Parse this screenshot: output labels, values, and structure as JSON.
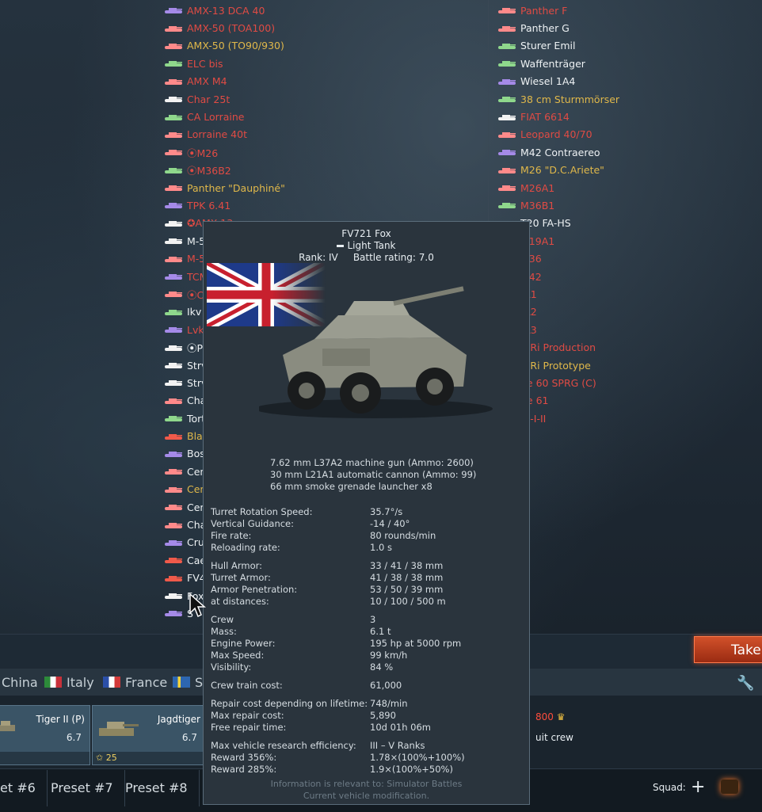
{
  "left_list": [
    {
      "name": "AMX-13 DCA 40",
      "color": "red",
      "icon": "spaa-purple"
    },
    {
      "name": "AMX-50 (TOA100)",
      "color": "red",
      "icon": "heavy-pink"
    },
    {
      "name": "AMX-50 (TO90/930)",
      "color": "gold",
      "icon": "heavy-pink"
    },
    {
      "name": "ELC bis",
      "color": "red",
      "icon": "light-green"
    },
    {
      "name": "AMX M4",
      "color": "red",
      "icon": "heavy-pink"
    },
    {
      "name": "Char 25t",
      "color": "red",
      "icon": "medium-white"
    },
    {
      "name": "CA Lorraine",
      "color": "red",
      "icon": "td-green"
    },
    {
      "name": "Lorraine 40t",
      "color": "red",
      "icon": "medium-pink"
    },
    {
      "name": "⦿M26",
      "color": "red",
      "icon": "heavy-pink"
    },
    {
      "name": "⦿M36B2",
      "color": "red",
      "icon": "td-green"
    },
    {
      "name": "Panther \"Dauphiné\"",
      "color": "gold",
      "icon": "medium-pink"
    },
    {
      "name": "TPK 6.41",
      "color": "red",
      "icon": "spaa-purple"
    },
    {
      "name": "✪AMX-13",
      "color": "red",
      "icon": "medium-white"
    },
    {
      "name": "M-5",
      "color": "white",
      "icon": "medium-white"
    },
    {
      "name": "M-5",
      "color": "red",
      "icon": "medium-pink"
    },
    {
      "name": "TCM",
      "color": "red",
      "icon": "spaa-purple"
    },
    {
      "name": "⦿C",
      "color": "red",
      "icon": "heavy-pink"
    },
    {
      "name": "Ikv",
      "color": "white",
      "icon": "td-green"
    },
    {
      "name": "Lvkv",
      "color": "red",
      "icon": "spaa-purple"
    },
    {
      "name": "⦿P",
      "color": "white",
      "icon": "medium-white"
    },
    {
      "name": "Strv",
      "color": "white",
      "icon": "medium-white"
    },
    {
      "name": "Strv",
      "color": "white",
      "icon": "medium-white"
    },
    {
      "name": "Cha",
      "color": "white",
      "icon": "heavy-pink"
    },
    {
      "name": "Tort",
      "color": "white",
      "icon": "td-green"
    },
    {
      "name": "Blac",
      "color": "gold",
      "icon": "heavy-red"
    },
    {
      "name": "Bosv",
      "color": "white",
      "icon": "spaa-purple"
    },
    {
      "name": "Cent",
      "color": "white",
      "icon": "medium-pink"
    },
    {
      "name": "Cent",
      "color": "gold",
      "icon": "medium-pink"
    },
    {
      "name": "Cent",
      "color": "white",
      "icon": "medium-pink"
    },
    {
      "name": "Cha",
      "color": "white",
      "icon": "heavy-pink"
    },
    {
      "name": "Crus",
      "color": "white",
      "icon": "spaa-purple"
    },
    {
      "name": "Cae",
      "color": "white",
      "icon": "heavy-red"
    },
    {
      "name": "FV4",
      "color": "white",
      "icon": "heavy-red"
    },
    {
      "name": "Fox",
      "color": "white",
      "icon": "light-white"
    },
    {
      "name": "S",
      "color": "white",
      "icon": "spaa-purple"
    }
  ],
  "right_list": [
    {
      "name": "Panther F",
      "color": "red",
      "icon": "medium-pink"
    },
    {
      "name": "Panther G",
      "color": "white",
      "icon": "medium-pink"
    },
    {
      "name": "Sturer Emil",
      "color": "white",
      "icon": "td-green"
    },
    {
      "name": "Waffenträger",
      "color": "white",
      "icon": "td-green"
    },
    {
      "name": "Wiesel 1A4",
      "color": "white",
      "icon": "spaa-purple"
    },
    {
      "name": "38 cm Sturmmörser",
      "color": "gold",
      "icon": "td-green"
    },
    {
      "name": "FIAT 6614",
      "color": "red",
      "icon": "light-white"
    },
    {
      "name": "Leopard 40/70",
      "color": "red",
      "icon": "medium-pink"
    },
    {
      "name": "M42 Contraereo",
      "color": "white",
      "icon": "spaa-purple"
    },
    {
      "name": "M26 \"D.C.Ariete\"",
      "color": "gold",
      "icon": "heavy-pink"
    },
    {
      "name": "M26A1",
      "color": "red",
      "icon": "heavy-pink"
    },
    {
      "name": "M36B1",
      "color": "red",
      "icon": "td-green"
    },
    {
      "name": "T20 FA-HS",
      "color": "white",
      "icon": "light-white"
    },
    {
      "name": "M19A1",
      "color": "red",
      "icon": "spaa-purple"
    },
    {
      "name": "M36",
      "color": "red",
      "icon": "td-green"
    },
    {
      "name": "M42",
      "color": "red",
      "icon": "spaa-purple"
    },
    {
      "name": "-A1",
      "color": "red",
      "icon": "medium-pink"
    },
    {
      "name": "-A2",
      "color": "red",
      "icon": "medium-pink"
    },
    {
      "name": "-A3",
      "color": "red",
      "icon": "medium-pink"
    },
    {
      "name": "o-Ri Production",
      "color": "red",
      "icon": "medium-pink"
    },
    {
      "name": "o-Ri Prototype",
      "color": "gold",
      "icon": "medium-pink"
    },
    {
      "name": "pe 60 SPRG (C)",
      "color": "red",
      "icon": "td-green"
    },
    {
      "name": "pe 61",
      "color": "red",
      "icon": "medium-pink"
    },
    {
      "name": "JB-I-II",
      "color": "red",
      "icon": "medium-pink"
    }
  ],
  "tooltip": {
    "name": "FV721 Fox",
    "class": "Light Tank",
    "rank_label": "Rank:",
    "rank": "IV",
    "br_label": "Battle rating:",
    "br": "7.0",
    "weapons": [
      "7.62 mm L37A2 machine gun (Ammo: 2600)",
      "30 mm L21A1 automatic cannon (Ammo: 99)",
      "66 mm smoke grenade launcher x8"
    ],
    "stats": [
      {
        "label": "Turret Rotation Speed:",
        "value": "35.7°/s"
      },
      {
        "label": "Vertical Guidance:",
        "value": "-14 / 40°"
      },
      {
        "label": "Fire rate:",
        "value": "80 rounds/min"
      },
      {
        "label": "Reloading rate:",
        "value": "1.0 s"
      },
      {
        "label": "Hull Armor:",
        "value": "33 / 41 / 38 mm"
      },
      {
        "label": "Turret Armor:",
        "value": "41 / 38 / 38 mm"
      },
      {
        "label": "Armor Penetration:",
        "value": "53 / 50 / 39 mm"
      },
      {
        "label": "at distances:",
        "value": "10 / 100 / 500 m"
      },
      {
        "label": "Crew",
        "value": "3"
      },
      {
        "label": "Mass:",
        "value": "6.1 t"
      },
      {
        "label": "Engine Power:",
        "value": "195 hp at 5000 rpm"
      },
      {
        "label": "Max Speed:",
        "value": "99 km/h"
      },
      {
        "label": "Visibility:",
        "value": "84 %"
      },
      {
        "label": "Crew train cost:",
        "value": "61,000"
      },
      {
        "label": "Repair cost depending on lifetime:",
        "value": "748/min"
      },
      {
        "label": "Max repair cost:",
        "value": "5,890"
      },
      {
        "label": "Free repair time:",
        "value": "10d 01h 06m"
      },
      {
        "label": "Max vehicle research efficiency:",
        "value": "III – V Ranks"
      },
      {
        "label": "Reward 356%:",
        "value": "1.78×(100%+100%)"
      },
      {
        "label": "Reward 285%:",
        "value": "1.9×(100%+50%)"
      }
    ],
    "footer_1": "Information is relevant to: Simulator Battles",
    "footer_2": "Current vehicle modification."
  },
  "take_button": "Take",
  "nations": [
    "China",
    "Italy",
    "France",
    "Sw"
  ],
  "slots": [
    {
      "name": "Tiger II (P)",
      "br": "6.7",
      "foot": ""
    },
    {
      "name": "Jagdtiger",
      "br": "6.7",
      "foot": "25"
    }
  ],
  "price": "800",
  "crew_label": "uit crew",
  "presets": [
    "et #6",
    "Preset #7",
    "Preset #8"
  ],
  "squad_label": "Squad:",
  "colors": {
    "red": "#e04b44",
    "gold": "#e0b84a",
    "white": "#eef2f4",
    "accent_orange": "#d2512a"
  }
}
